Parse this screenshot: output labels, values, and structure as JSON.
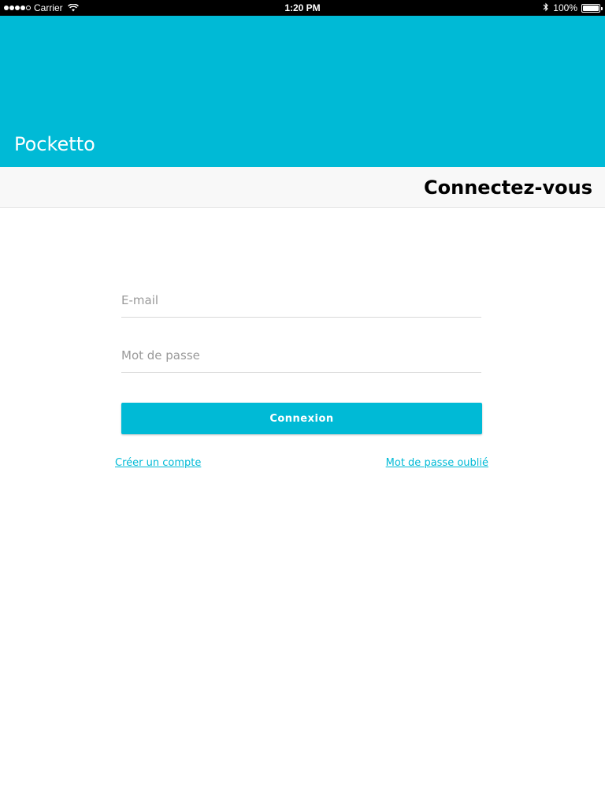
{
  "status_bar": {
    "carrier": "Carrier",
    "time": "1:20 PM",
    "battery": "100%",
    "icons": [
      "signal-icon",
      "wifi-icon",
      "bluetooth-icon",
      "battery-icon"
    ]
  },
  "header": {
    "app_title": "Pocketto",
    "color": "#00bad6"
  },
  "sub_header": {
    "title": "Connectez-vous"
  },
  "form": {
    "email_placeholder": "E-mail",
    "email_value": "",
    "password_placeholder": "Mot de passe",
    "password_value": "",
    "submit_label": "Connexion"
  },
  "links": {
    "create_account": "Créer un compte",
    "forgot_password": "Mot de passe oublié"
  },
  "colors": {
    "accent": "#00bad6",
    "divider": "#d9d9d9",
    "placeholder": "#9a9a9a"
  }
}
